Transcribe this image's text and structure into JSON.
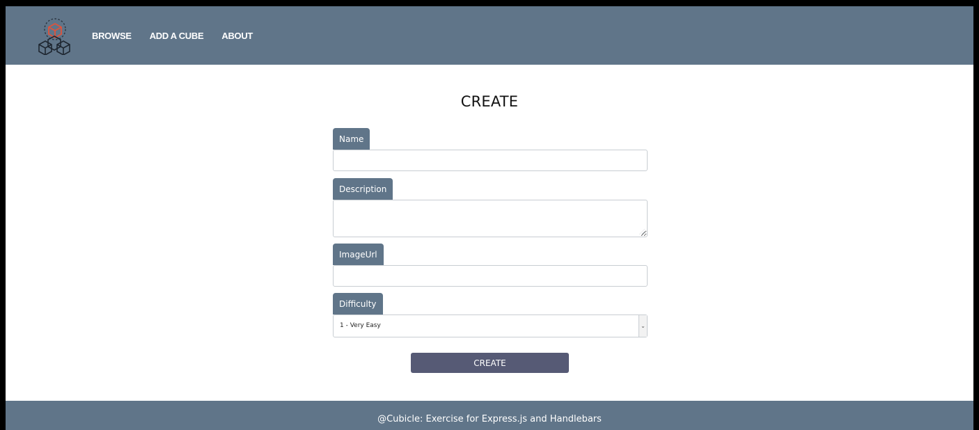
{
  "nav": {
    "items": [
      "BROWSE",
      "ADD A CUBE",
      "ABOUT"
    ]
  },
  "page_title": "CREATE",
  "form": {
    "name_label": "Name",
    "name_value": "",
    "description_label": "Description",
    "description_value": "",
    "imageurl_label": "ImageUrl",
    "imageurl_value": "",
    "difficulty_label": "Difficulty",
    "difficulty_value": "1 - Very Easy",
    "submit_label": "CREATE"
  },
  "footer": {
    "text": "@Cubicle: Exercise for Express.js and Handlebars"
  },
  "colors": {
    "header_bg": "#607589",
    "button_bg": "#565a75",
    "logo_accent": "#e0533b"
  },
  "icons": {
    "logo": "cubes-logo-icon",
    "select_arrow": "chevron-down-icon"
  }
}
